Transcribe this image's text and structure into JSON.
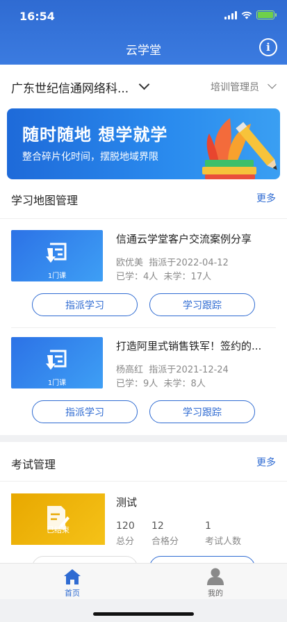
{
  "status_bar": {
    "time": "16:54"
  },
  "header": {
    "title": "云学堂",
    "info_icon": "info-icon"
  },
  "company": {
    "name": "广东世纪信通网络科...",
    "role": "培训管理员"
  },
  "banner": {
    "title": "随时随地 想学就学",
    "subtitle": "整合碎片化时间，摆脱地域界限"
  },
  "learning_map": {
    "title": "学习地图管理",
    "more": "更多",
    "items": [
      {
        "thumb_label": "1门课",
        "title": "信通云学堂客户交流案例分享",
        "assigner": "欧优美",
        "assign_date": "指派于2022-04-12",
        "learned": "已学：4人",
        "not_learned": "未学：17人",
        "btn_assign": "指派学习",
        "btn_track": "学习跟踪"
      },
      {
        "thumb_label": "1门课",
        "title": "打造阿里式销售铁军！签约的...",
        "assigner": "杨高红",
        "assign_date": "指派于2021-12-24",
        "learned": "已学：9人",
        "not_learned": "未学：8人",
        "btn_assign": "指派学习",
        "btn_track": "学习跟踪"
      }
    ]
  },
  "exam": {
    "title": "考试管理",
    "more": "更多",
    "item": {
      "thumb_label": "已结束",
      "title": "测试",
      "total_score": "120",
      "total_score_label": "总分",
      "pass_score": "12",
      "pass_score_label": "合格分",
      "examinees": "1",
      "examinees_label": "考试人数"
    }
  },
  "tabbar": {
    "home": "首页",
    "me": "我的"
  },
  "colors": {
    "primary": "#2f6bd2",
    "accent_yellow": "#f5c218"
  }
}
